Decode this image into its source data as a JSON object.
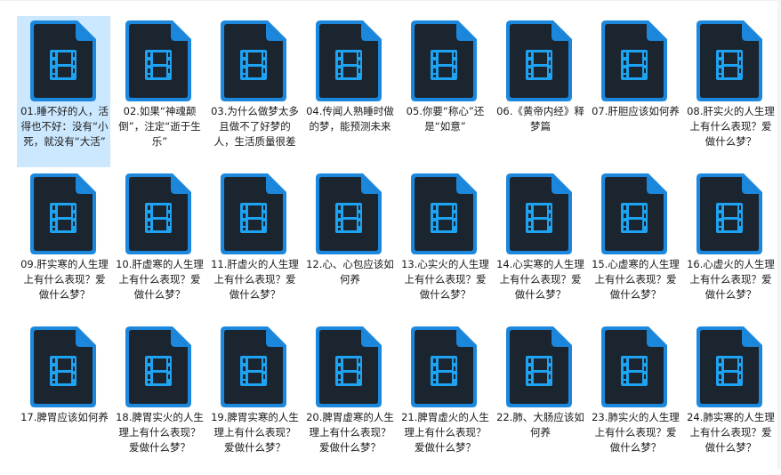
{
  "files": [
    {
      "name": "01.睡不好的人，活得也不好：没有“小死，就没有“大活”",
      "icon": "video-file-icon",
      "selected": true
    },
    {
      "name": "02.如果“神魂颠倒”，注定“逝于生乐”",
      "icon": "video-file-icon"
    },
    {
      "name": "03.为什么做梦太多且做不了好梦的人，生活质量很差",
      "icon": "video-file-icon"
    },
    {
      "name": "04.传闻人熟睡时做的梦，能预测未来",
      "icon": "video-file-icon"
    },
    {
      "name": "05.你要“称心”还是“如意”",
      "icon": "video-file-icon"
    },
    {
      "name": "06.《黄帝内经》释梦篇",
      "icon": "video-file-icon"
    },
    {
      "name": "07.肝胆应该如何养",
      "icon": "video-file-icon"
    },
    {
      "name": "08.肝实火的人生理上有什么表现？爱做什么梦？",
      "icon": "video-file-icon"
    },
    {
      "name": "09.肝实寒的人生理上有什么表现？爱做什么梦？",
      "icon": "video-file-icon"
    },
    {
      "name": "10.肝虚寒的人生理上有什么表现？爱做什么梦？",
      "icon": "video-file-icon"
    },
    {
      "name": "11.肝虚火的人生理上有什么表现？爱做什么梦？",
      "icon": "video-file-icon"
    },
    {
      "name": "12.心、心包应该如何养",
      "icon": "video-file-icon"
    },
    {
      "name": "13.心实火的人生理上有什么表现？爱做什么梦？",
      "icon": "video-file-icon"
    },
    {
      "name": "14.心实寒的人生理上有什么表现？爱做什么梦？",
      "icon": "video-file-icon"
    },
    {
      "name": "15.心虚寒的人生理上有什么表现？爱做什么梦？",
      "icon": "video-file-icon"
    },
    {
      "name": "16.心虚火的人生理上有什么表现？爱做什么梦？",
      "icon": "video-file-icon"
    },
    {
      "name": "17.脾胃应该如何养",
      "icon": "video-file-icon"
    },
    {
      "name": "18.脾胃实火的人生理上有什么表现？爱做什么梦？",
      "icon": "video-file-icon"
    },
    {
      "name": "19.脾胃实寒的人生理上有什么表现？爱做什么梦？",
      "icon": "video-file-icon"
    },
    {
      "name": "20.脾胃虚寒的人生理上有什么表现？爱做什么梦？",
      "icon": "video-file-icon"
    },
    {
      "name": "21.脾胃虚火的人生理上有什么表现？爱做什么梦？",
      "icon": "video-file-icon"
    },
    {
      "name": "22.肺、大肠应该如何养",
      "icon": "video-file-icon"
    },
    {
      "name": "23.肺实火的人生理上有什么表现？爱做什么梦？",
      "icon": "video-file-icon"
    },
    {
      "name": "24.肺实寒的人生理上有什么表现？爱做什么梦？",
      "icon": "video-file-icon"
    }
  ],
  "colors": {
    "icon_body": "#1b2530",
    "icon_border": "#1c88dd",
    "icon_glyph": "#1ea2f2",
    "selection": "#cce8ff"
  }
}
